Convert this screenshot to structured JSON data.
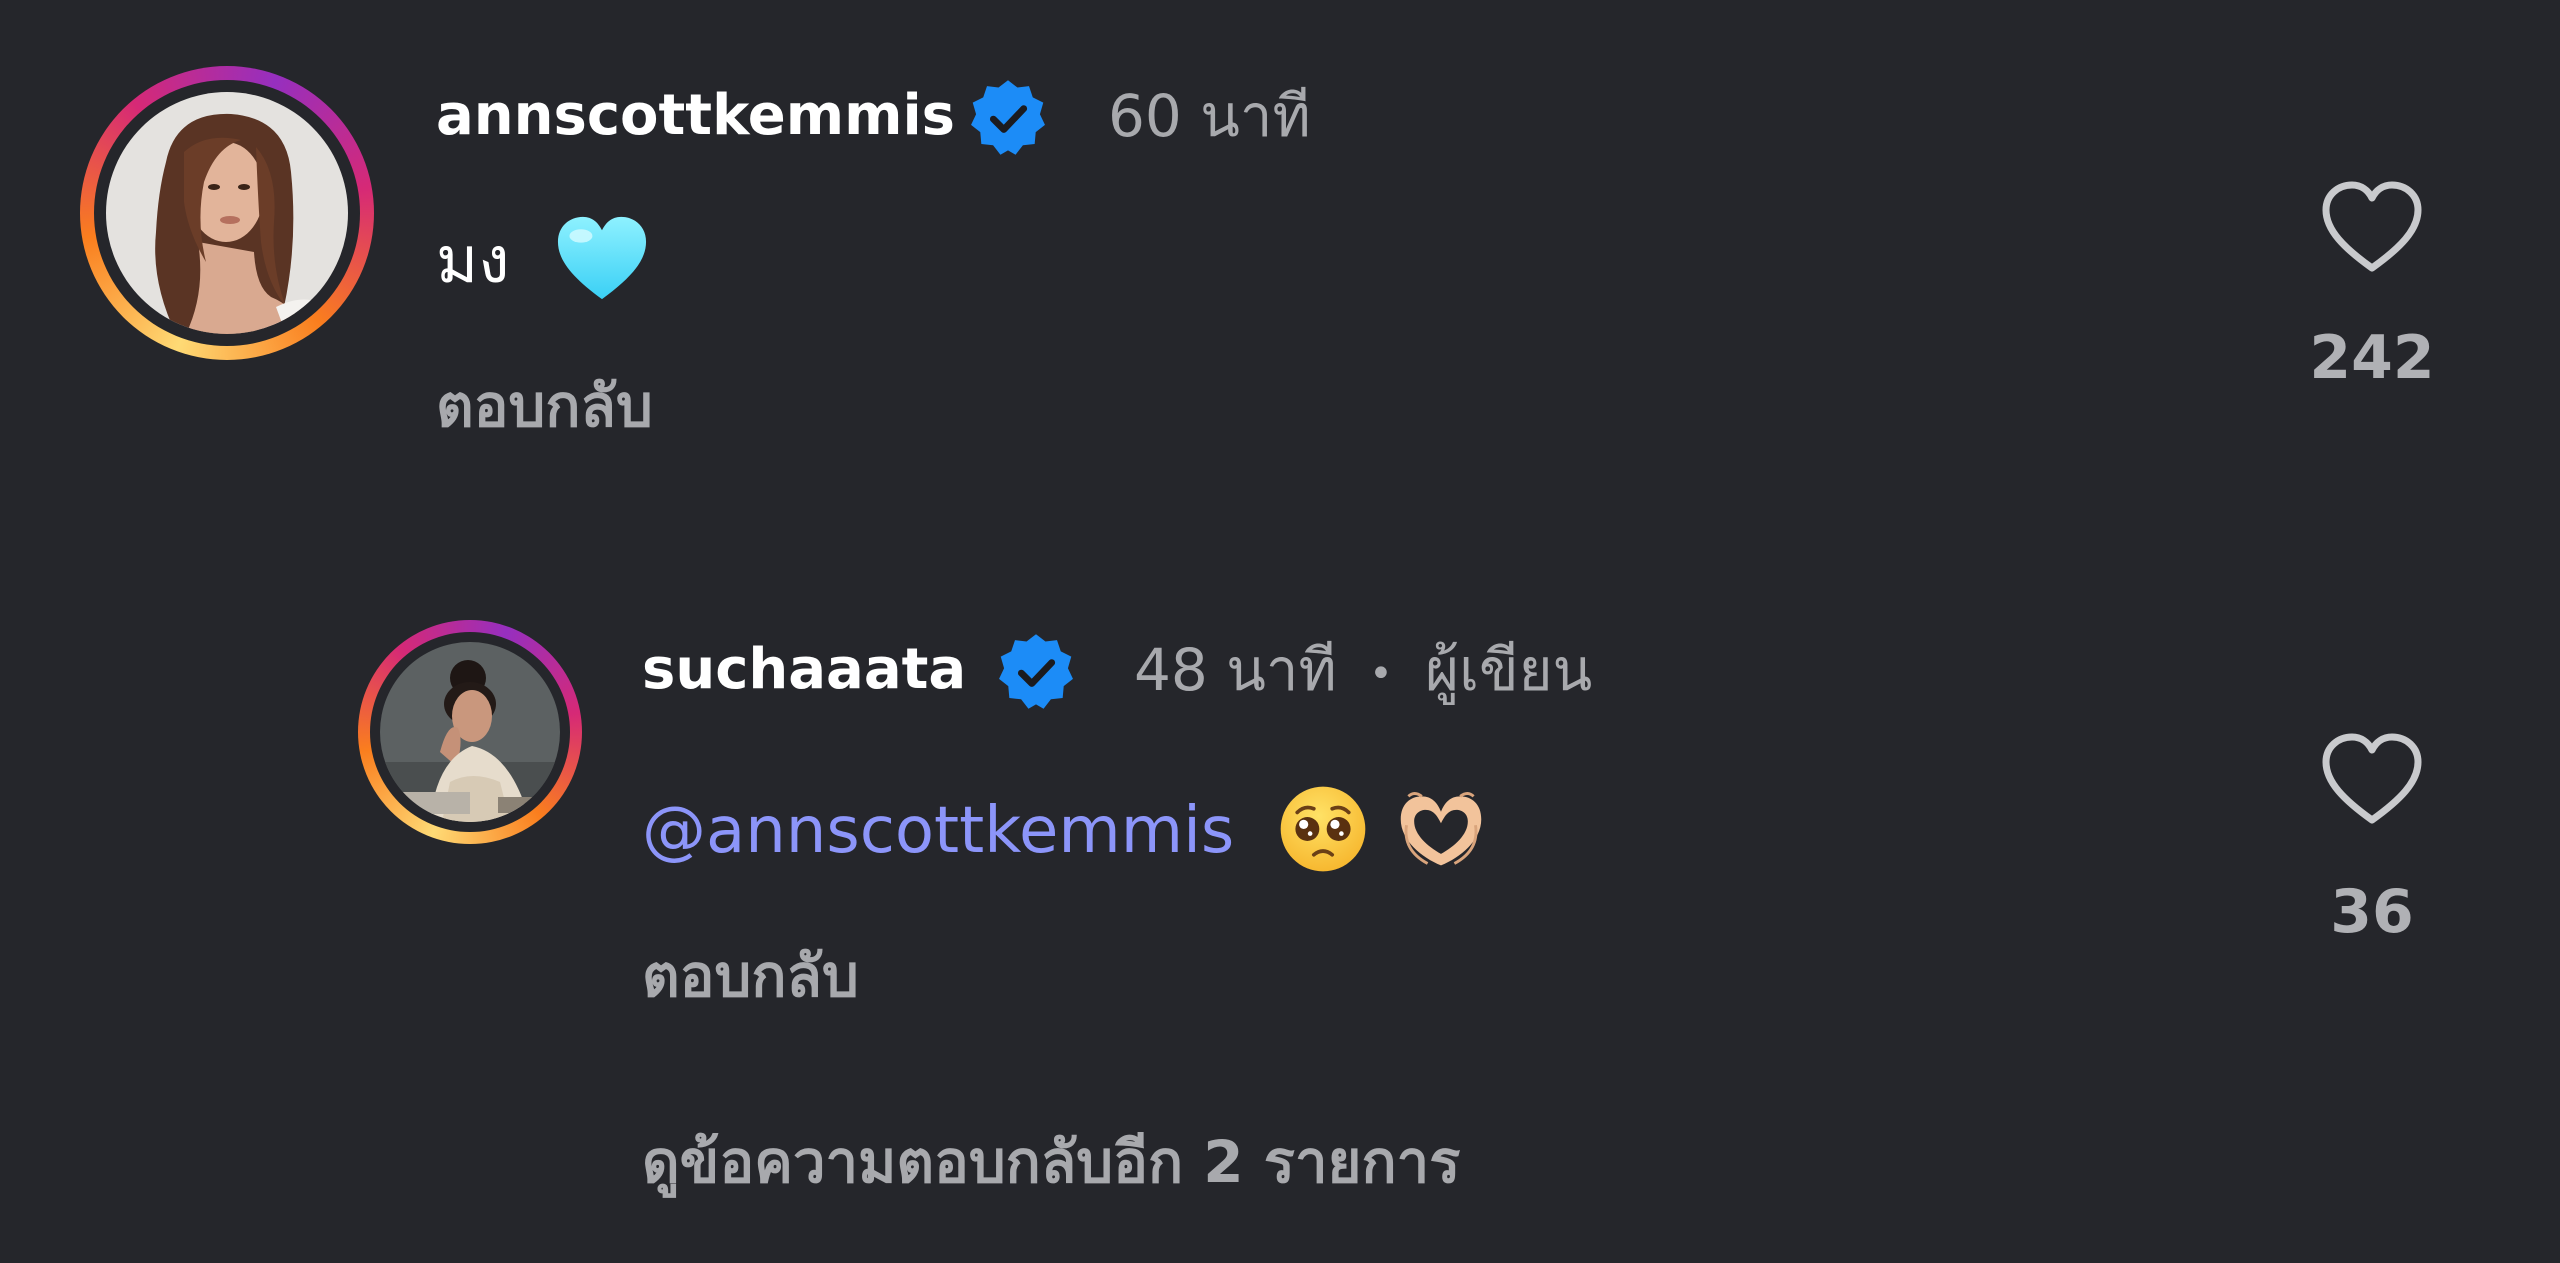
{
  "comments": [
    {
      "username": "annscottkemmis",
      "time": "60 นาที",
      "text": "มง",
      "emoji": "light-blue-heart",
      "reply_label": "ตอบกลับ",
      "likes": "242"
    },
    {
      "username": "suchaaata",
      "time": "48 นาที",
      "separator": "•",
      "author_label": "ผู้เขียน",
      "mention": "@annscottkemmis",
      "emojis": [
        "pleading-face",
        "heart-hands"
      ],
      "reply_label": "ตอบกลับ",
      "likes": "36"
    }
  ],
  "view_more_replies": "ดูข้อความตอบกลับอีก 2 รายการ",
  "colors": {
    "background": "#25262b",
    "mention": "#8c95f9",
    "secondary_text": "#a8a9ad",
    "verified": "#1c8cf7"
  }
}
